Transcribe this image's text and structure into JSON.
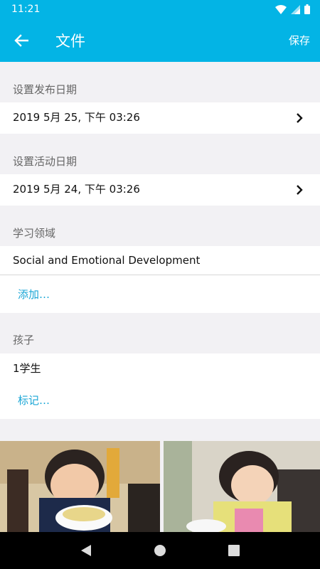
{
  "status": {
    "time": "11:21"
  },
  "app_bar": {
    "title": "文件",
    "save_label": "保存"
  },
  "publish_date": {
    "label": "设置发布日期",
    "value": "2019 5月 25, 下午 03:26"
  },
  "activity_date": {
    "label": "设置活动日期",
    "value": "2019 5月 24, 下午 03:26"
  },
  "learning_areas": {
    "label": "学习领域",
    "items": [
      "Social and Emotional Development"
    ],
    "add_label": "添加…"
  },
  "children": {
    "label": "孩子",
    "value": "1学生",
    "tag_label": "标记…"
  },
  "photos": [
    {
      "desc_icon": "child-eating-photo-1"
    },
    {
      "desc_icon": "child-eating-photo-2"
    }
  ],
  "colors": {
    "primary": "#03b4e5",
    "link": "#1aa6d6",
    "background": "#f2f1f4"
  }
}
